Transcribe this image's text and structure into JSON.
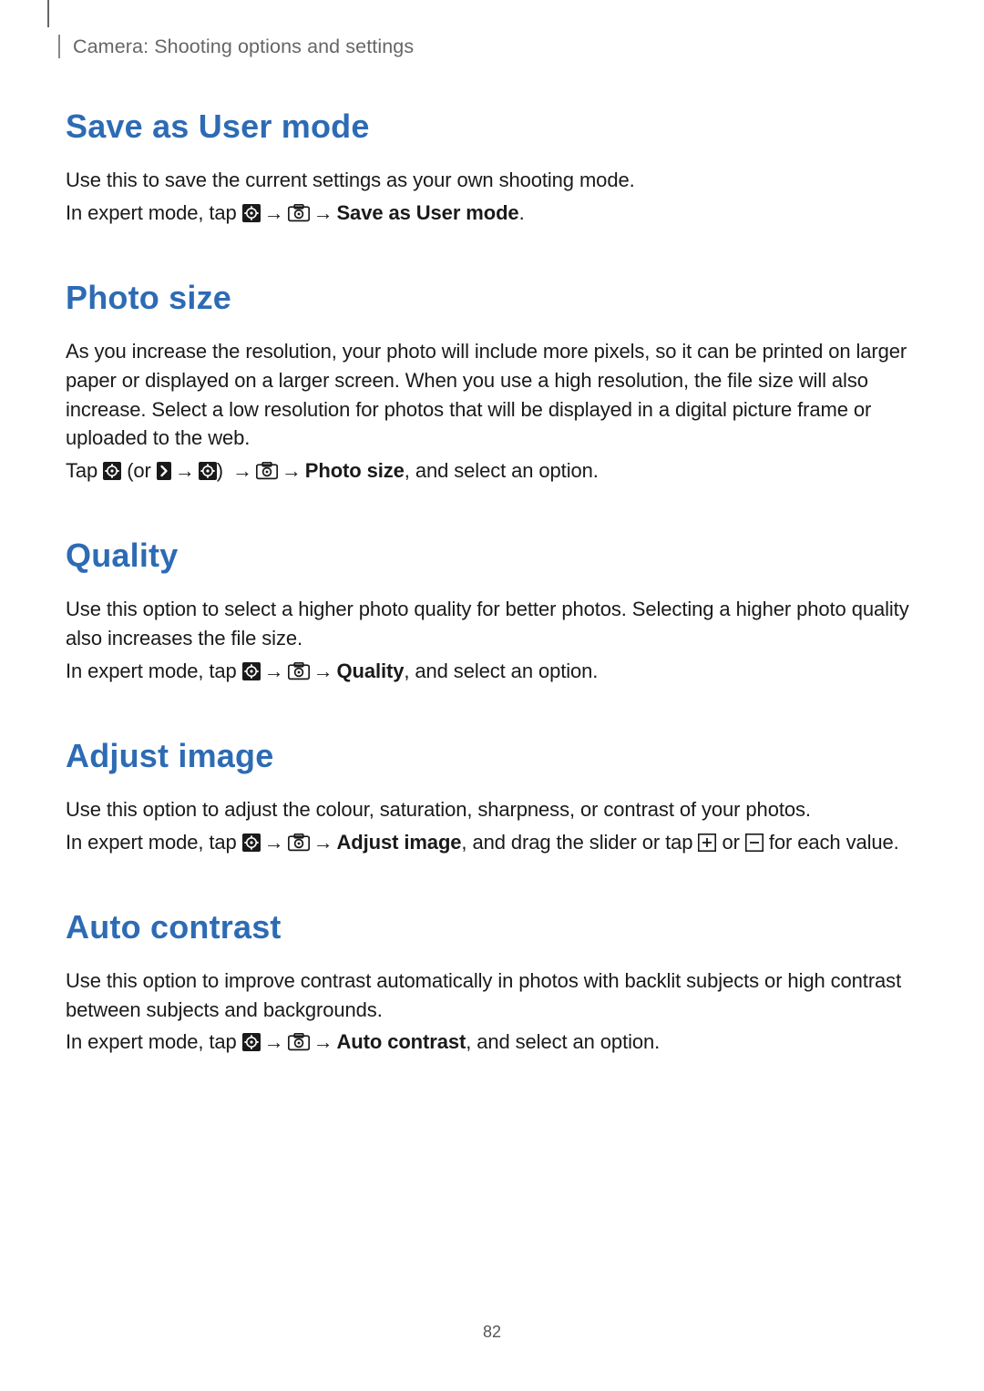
{
  "header": {
    "breadcrumb": "Camera: Shooting options and settings"
  },
  "arrow": "→",
  "sections": {
    "save_as_user_mode": {
      "heading": "Save as User mode",
      "p1": "Use this to save the current settings as your own shooting mode.",
      "p2_prefix": "In expert mode, tap ",
      "p2_bold": "Save as User mode",
      "p2_suffix": "."
    },
    "photo_size": {
      "heading": "Photo size",
      "p1": "As you increase the resolution, your photo will include more pixels, so it can be printed on larger paper or displayed on a larger screen. When you use a high resolution, the file size will also increase. Select a low resolution for photos that will be displayed in a digital picture frame or uploaded to the web.",
      "p2_prefix": "Tap ",
      "p2_or_open": " (or ",
      "p2_or_close": ") ",
      "p2_bold": "Photo size",
      "p2_suffix": ", and select an option."
    },
    "quality": {
      "heading": "Quality",
      "p1": "Use this option to select a higher photo quality for better photos. Selecting a higher photo quality also increases the file size.",
      "p2_prefix": "In expert mode, tap ",
      "p2_bold": "Quality",
      "p2_suffix": ", and select an option."
    },
    "adjust_image": {
      "heading": "Adjust image",
      "p1": "Use this option to adjust the colour, saturation, sharpness, or contrast of your photos.",
      "p2_prefix": "In expert mode, tap ",
      "p2_bold": "Adjust image",
      "p2_mid": ", and drag the slider or tap ",
      "p2_or": " or ",
      "p2_suffix": " for each value."
    },
    "auto_contrast": {
      "heading": "Auto contrast",
      "p1": "Use this option to improve contrast automatically in photos with backlit subjects or high contrast between subjects and backgrounds.",
      "p2_prefix": "In expert mode, tap ",
      "p2_bold": "Auto contrast",
      "p2_suffix": ", and select an option."
    }
  },
  "page_number": "82"
}
